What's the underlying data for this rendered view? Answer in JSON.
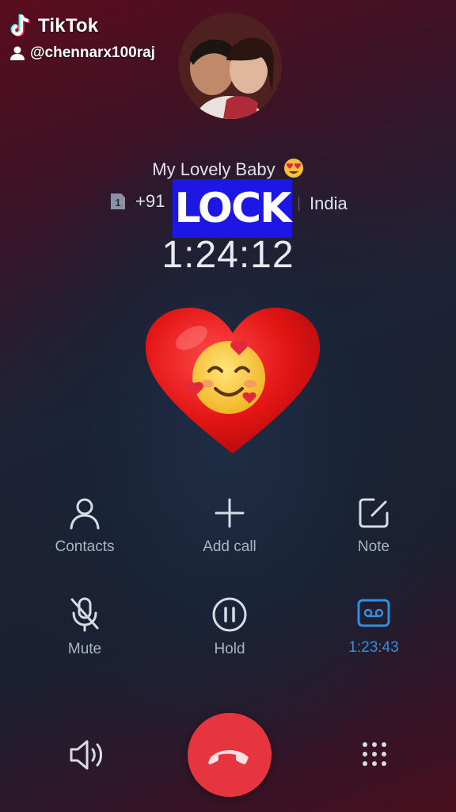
{
  "watermark": {
    "brand": "TikTok",
    "username": "@chennarx100raj"
  },
  "call": {
    "caller_name": "My Lovely Baby",
    "country_code": "+91",
    "number_overlay": "LOCK",
    "country": "India",
    "duration": "1:24:12"
  },
  "actions": [
    {
      "label": "Contacts",
      "icon": "person-icon"
    },
    {
      "label": "Add call",
      "icon": "plus-icon"
    },
    {
      "label": "Note",
      "icon": "note-edit-icon"
    },
    {
      "label": "Mute",
      "icon": "mic-off-icon"
    },
    {
      "label": "Hold",
      "icon": "pause-icon"
    },
    {
      "label": "1:23:43",
      "icon": "recorder-icon",
      "color": "#2f8fe0"
    }
  ],
  "bottom": {
    "speaker_icon": "speaker-icon",
    "end_call_icon": "end-call-icon",
    "dialpad_icon": "dialpad-icon"
  },
  "colors": {
    "end_call": "#e6353f",
    "accent": "#2f8fe0",
    "overlay": "#1d17e6"
  }
}
